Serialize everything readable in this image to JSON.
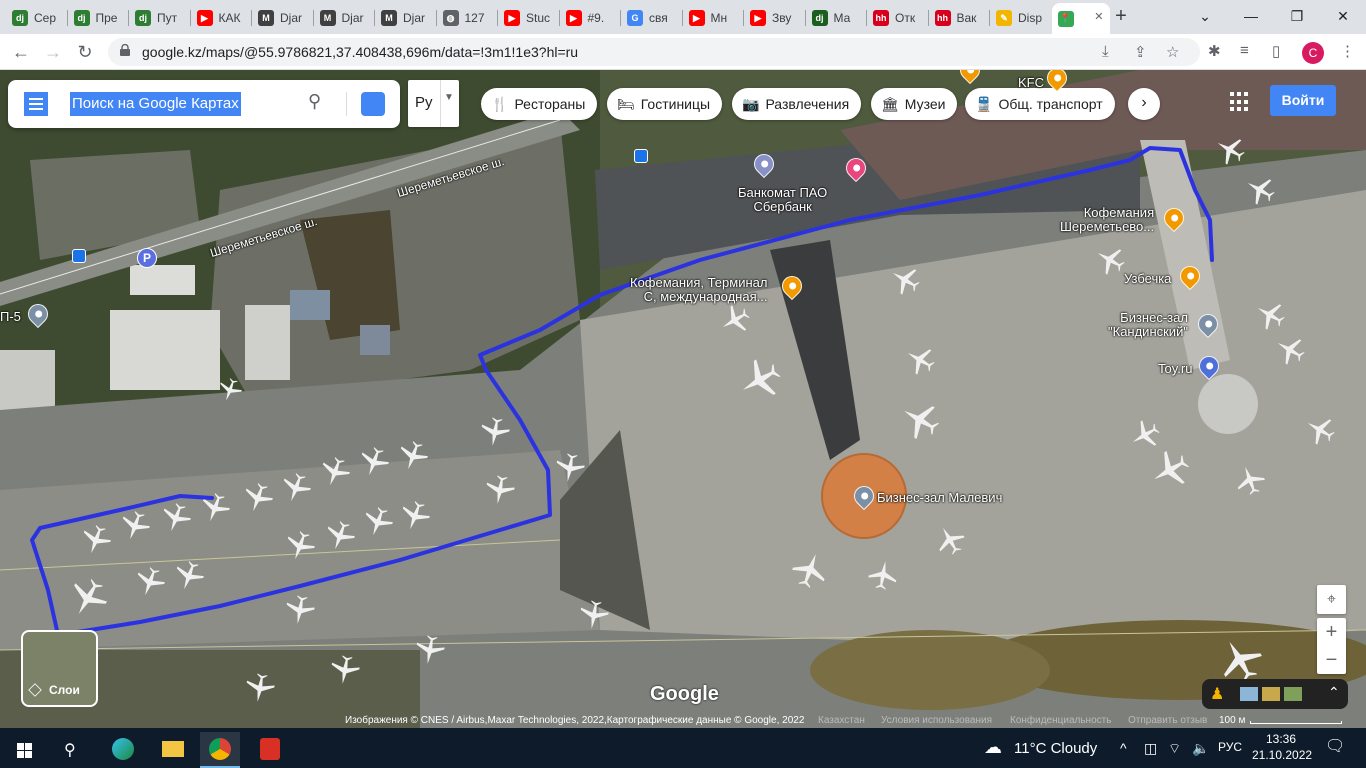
{
  "browser": {
    "tabs": [
      {
        "label": "Сер",
        "fav": "dj",
        "color": "#2e7d32"
      },
      {
        "label": "Пре",
        "fav": "dj",
        "color": "#2e7d32"
      },
      {
        "label": "Пут",
        "fav": "dj",
        "color": "#2e7d32"
      },
      {
        "label": "КАК",
        "fav": "▶",
        "color": "#ff0000"
      },
      {
        "label": "Djar",
        "fav": "M",
        "color": "#404040"
      },
      {
        "label": "Djar",
        "fav": "M",
        "color": "#404040"
      },
      {
        "label": "Djar",
        "fav": "M",
        "color": "#404040"
      },
      {
        "label": "127",
        "fav": "◍",
        "color": "#5f6368"
      },
      {
        "label": "Stuc",
        "fav": "▶",
        "color": "#ff0000"
      },
      {
        "label": "#9.",
        "fav": "▶",
        "color": "#ff0000"
      },
      {
        "label": "свя",
        "fav": "G",
        "color": "#4285f4"
      },
      {
        "label": "Мн",
        "fav": "▶",
        "color": "#ff0000"
      },
      {
        "label": "Зву",
        "fav": "▶",
        "color": "#ff0000"
      },
      {
        "label": "Ма",
        "fav": "dj",
        "color": "#1b5e20"
      },
      {
        "label": "Отк",
        "fav": "hh",
        "color": "#d6001c"
      },
      {
        "label": "Вак",
        "fav": "hh",
        "color": "#d6001c"
      },
      {
        "label": "Disp",
        "fav": "✎",
        "color": "#f2b600"
      },
      {
        "label": "",
        "fav": "📍",
        "color": "#34a853",
        "active": true
      }
    ],
    "url": "google.kz/maps/@55.9786821,37.408438,696m/data=!3m1!1e3?hl=ru",
    "profile_initial": "C"
  },
  "maps": {
    "search": {
      "placeholder": "Поиск на Google Картах",
      "selected_text": "Поиск на Google Картах"
    },
    "language": "Ру",
    "chips": [
      {
        "label": "Рестораны",
        "icon": "fork-knife-icon",
        "glyph": "🍴"
      },
      {
        "label": "Гостиницы",
        "icon": "bed-icon",
        "glyph": "🛏"
      },
      {
        "label": "Развлечения",
        "icon": "camera-icon",
        "glyph": "📷"
      },
      {
        "label": "Музеи",
        "icon": "museum-icon",
        "glyph": "🏛"
      },
      {
        "label": "Общ. транспорт",
        "icon": "transit-icon",
        "glyph": "🚆"
      }
    ],
    "signin": "Войти",
    "pois": [
      {
        "label": "KFC",
        "color": "#f29900"
      },
      {
        "label": "Банкомат ПАО\nСбербанк",
        "color": "#8791c8"
      },
      {
        "label": "Кофемания\nШереметьево...",
        "color": "#f29900"
      },
      {
        "label": "Кофемания, Терминал\nС, международная...",
        "color": "#f29900"
      },
      {
        "label": "Узбечка",
        "color": "#f29900"
      },
      {
        "label": "Бизнес-зал\n\"Кандинский\"",
        "color": "#7b8fa6"
      },
      {
        "label": "Toy.ru",
        "color": "#4f6fd9"
      },
      {
        "label": "Бизнес-зал Малевич",
        "color": "#7b8fa6"
      },
      {
        "label": "П-5",
        "color": "#7b8fa6"
      }
    ],
    "roads": [
      "Шереметьевское ш.",
      "Шереметьевское ш."
    ],
    "parking": "P",
    "layers_label": "Слои",
    "google_logo": "Google",
    "attribution": {
      "imagery": "Изображения © CNES / Airbus,Maxar Technologies, 2022,Картографические данные © Google, 2022",
      "country": "Казахстан",
      "terms": "Условия использования",
      "privacy": "Конфиденциальность",
      "feedback": "Отправить отзыв",
      "scale": "100 м"
    },
    "zoom_in": "+",
    "zoom_out": "−"
  },
  "taskbar": {
    "weather": "11°C  Cloudy",
    "lang": "РУС",
    "time": "13:36",
    "date": "21.10.2022"
  }
}
